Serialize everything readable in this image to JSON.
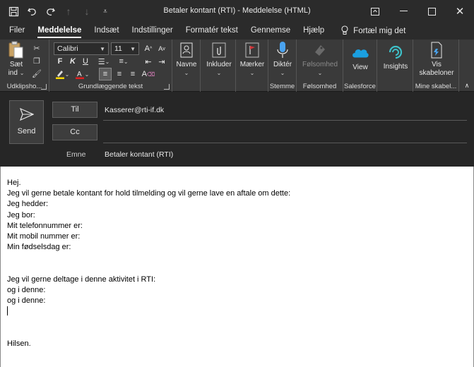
{
  "window": {
    "title": "Betaler kontant (RTI)  -  Meddelelse (HTML)"
  },
  "tabs": [
    {
      "label": "Filer"
    },
    {
      "label": "Meddelelse"
    },
    {
      "label": "Indsæt"
    },
    {
      "label": "Indstillinger"
    },
    {
      "label": "Formatér tekst"
    },
    {
      "label": "Gennemse"
    },
    {
      "label": "Hjælp"
    }
  ],
  "tell_me": "Fortæl mig det",
  "ribbon": {
    "clipboard": {
      "paste_label_1": "Sæt",
      "paste_label_2": "ind",
      "group_label": "Udklipsho..."
    },
    "basic_text": {
      "font": "Calibri",
      "size": "11",
      "group_label": "Grundlæggende tekst",
      "bold": "F",
      "italic": "K",
      "underline": "U"
    },
    "names": {
      "label": "Navne"
    },
    "include": {
      "label": "Inkluder"
    },
    "tags": {
      "label": "Mærker"
    },
    "dictate": {
      "label": "Diktér",
      "group_label": "Stemme"
    },
    "sensitivity": {
      "label": "Følsomhed",
      "group_label": "Følsomhed"
    },
    "view": {
      "label": "View",
      "group_label": "Salesforce"
    },
    "insights": {
      "label": "Insights"
    },
    "templates": {
      "label_1": "Vis",
      "label_2": "skabeloner",
      "group_label": "Mine skabel..."
    }
  },
  "header": {
    "send_label": "Send",
    "to_label": "Til",
    "cc_label": "Cc",
    "subject_label": "Emne",
    "to_value": "Kasserer@rti-if.dk",
    "subject_value": "Betaler kontant (RTI)"
  },
  "body_lines": [
    "Hej.",
    "Jeg vil gerne betale kontant for hold tilmelding og vil gerne lave en aftale om dette:",
    "Jeg hedder:",
    "Jeg bor:",
    "Mit telefonnummer er:",
    "Mit mobil nummer er:",
    "Min fødselsdag er:",
    "",
    "",
    "Jeg vil gerne deltage i denne aktivitet i RTI:",
    "og i denne:",
    "og i denne:",
    "",
    "",
    "Hilsen."
  ],
  "icons": {
    "save": "save-icon",
    "undo": "undo-icon",
    "redo": "redo-icon"
  },
  "colors": {
    "accent_blue": "#4aa3f0",
    "flag_red": "#d13438",
    "salesforce": "#1a9fe0"
  }
}
